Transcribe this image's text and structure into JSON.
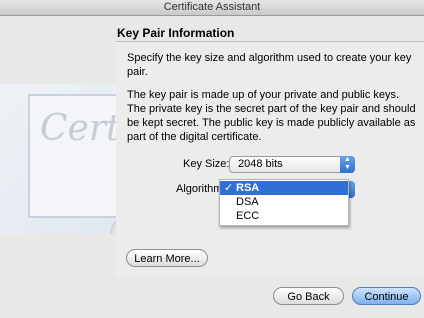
{
  "window": {
    "title": "Certificate Assistant"
  },
  "section": {
    "title": "Key Pair Information"
  },
  "description": {
    "p1": "Specify the key size and algorithm used to create your key pair.",
    "p2": "The key pair is made up of your private and public keys. The private key is the secret part of the key pair and should be kept secret. The public key is made publicly available as part of the digital certificate."
  },
  "form": {
    "key_size": {
      "label": "Key Size:",
      "value": "2048 bits"
    },
    "algorithm": {
      "label": "Algorithm",
      "options": [
        "RSA",
        "DSA",
        "ECC"
      ],
      "selected": "RSA",
      "checkmark": "✓"
    }
  },
  "background": {
    "certificate_watermark": "Certif"
  },
  "buttons": {
    "learn_more": "Learn More...",
    "go_back": "Go Back",
    "continue": "Continue"
  },
  "colors": {
    "menu_highlight": "#2f6fd6"
  }
}
